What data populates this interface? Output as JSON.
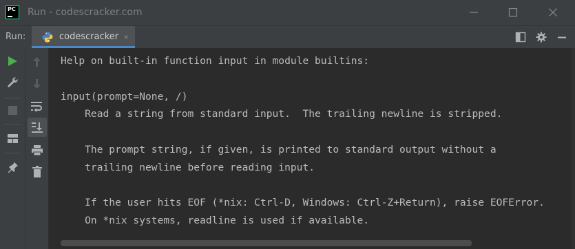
{
  "window": {
    "title": "Run - codescracker.com",
    "logo_text": "PC"
  },
  "run_panel": {
    "label": "Run:",
    "tab_label": "codescracker",
    "tab_close": "×"
  },
  "console": {
    "lines": [
      "Help on built-in function input in module builtins:",
      "",
      "input(prompt=None, /)",
      "    Read a string from standard input.  The trailing newline is stripped.",
      "",
      "    The prompt string, if given, is printed to standard output without a",
      "    trailing newline before reading input.",
      "",
      "    If the user hits EOF (*nix: Ctrl-D, Windows: Ctrl-Z+Return), raise EOFError.",
      "    On *nix systems, readline is used if available."
    ]
  },
  "icons": {
    "minimize": "minimize-icon",
    "maximize": "maximize-icon",
    "close": "close-icon",
    "layout": "layout-icon",
    "settings": "gear-icon",
    "hide": "minimize-panel-icon",
    "run": "run-icon",
    "wrench": "wrench-icon",
    "stop": "stop-icon",
    "layout_grid": "restore-layout-icon",
    "pin": "pin-icon",
    "up": "arrow-up-icon",
    "down": "arrow-down-icon",
    "soft_wrap": "soft-wrap-icon",
    "scroll_end": "scroll-to-end-icon",
    "print": "print-icon",
    "trash": "trash-icon"
  },
  "colors": {
    "run_green": "#4eae4d",
    "tab_underline": "#4a88c7",
    "console_bg": "#2b2b2b",
    "panel_bg": "#3c3f41",
    "text": "#bbbbbb"
  }
}
